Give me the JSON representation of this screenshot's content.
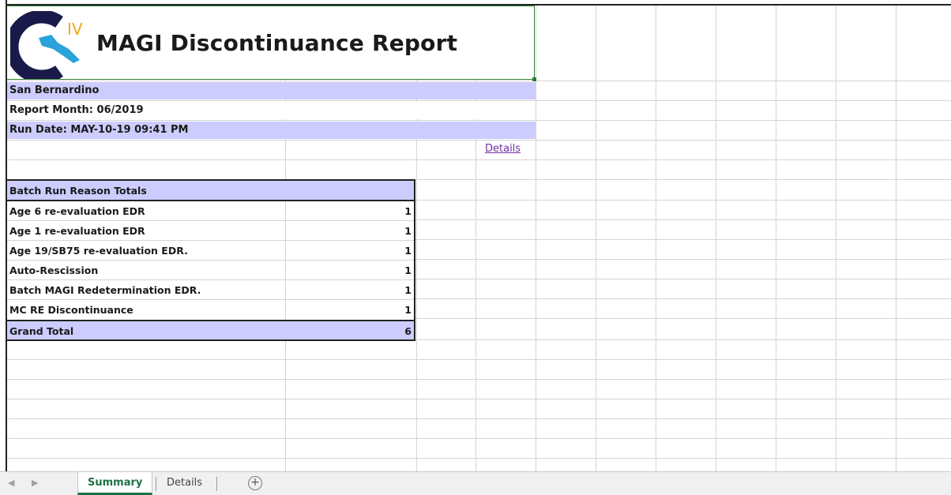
{
  "report": {
    "title": "MAGI Discontinuance Report",
    "logo_text": "IV",
    "county": "San Bernardino",
    "report_month": "Report Month: 06/2019",
    "run_date": "Run Date: MAY-10-19 09:41 PM",
    "details_link": "Details"
  },
  "table": {
    "header": "Batch Run Reason Totals",
    "rows": [
      {
        "label": "Age 6 re-evaluation EDR",
        "value": "1"
      },
      {
        "label": "Age 1 re-evaluation EDR",
        "value": "1"
      },
      {
        "label": "Age 19/SB75 re-evaluation EDR.",
        "value": "1"
      },
      {
        "label": "Auto-Rescission",
        "value": "1"
      },
      {
        "label": "Batch MAGI Redetermination EDR.",
        "value": "1"
      },
      {
        "label": "MC RE Discontinuance",
        "value": "1"
      }
    ],
    "total_label": "Grand Total",
    "total_value": "6"
  },
  "tabs": [
    {
      "label": "Summary",
      "active": true
    },
    {
      "label": "Details",
      "active": false
    }
  ],
  "add_sheet_symbol": "+",
  "colors": {
    "band": "#ccccff",
    "active_tab": "#1e7145",
    "link": "#7030a0",
    "logo_c": "#1a1a4a",
    "logo_map": "#29a3d9",
    "logo_iv": "#f0a818"
  }
}
